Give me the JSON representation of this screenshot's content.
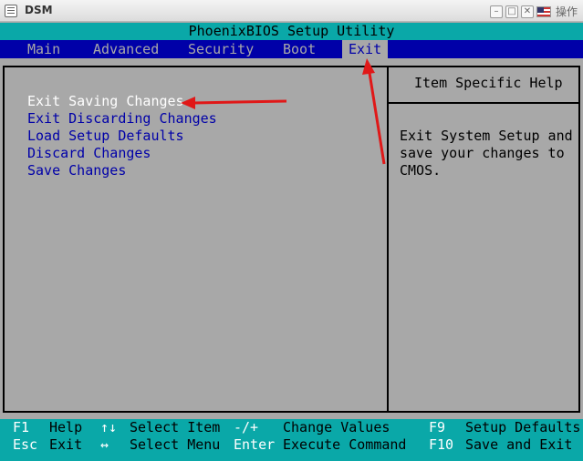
{
  "window": {
    "title": "DSM",
    "action_label": "操作",
    "icons": [
      "app-icon",
      "minimize-icon",
      "maximize-icon",
      "close-icon",
      "flag-icon"
    ]
  },
  "bios": {
    "title": "PhoenixBIOS Setup Utility",
    "menu": [
      {
        "label": "Main"
      },
      {
        "label": "Advanced"
      },
      {
        "label": "Security"
      },
      {
        "label": "Boot"
      },
      {
        "label": "Exit",
        "active": true
      }
    ],
    "options": [
      {
        "label": "Exit Saving Changes",
        "selected": true
      },
      {
        "label": "Exit Discarding Changes"
      },
      {
        "label": "Load Setup Defaults"
      },
      {
        "label": "Discard Changes"
      },
      {
        "label": "Save Changes"
      }
    ],
    "help": {
      "title": "Item Specific Help",
      "lines": [
        "Exit System Setup and",
        "save your changes to",
        "CMOS."
      ]
    },
    "footer": {
      "row1": [
        {
          "key": "F1",
          "desc": "Help"
        },
        {
          "key": "↑↓",
          "desc": "Select Item"
        },
        {
          "key": "-/+",
          "desc": "Change Values"
        },
        {
          "key": "F9",
          "desc": "Setup Defaults"
        }
      ],
      "row2": [
        {
          "key": "Esc",
          "desc": "Exit"
        },
        {
          "key": "↔",
          "desc": "Select Menu"
        },
        {
          "key": "Enter",
          "desc": "Execute Command"
        },
        {
          "key": "F10",
          "desc": "Save and Exit"
        }
      ]
    }
  },
  "colors": {
    "bios_blue": "#0000a8",
    "bios_cyan": "#0aa8a8",
    "bios_gray": "#a8a8a8",
    "annotation_red": "#e01818"
  }
}
